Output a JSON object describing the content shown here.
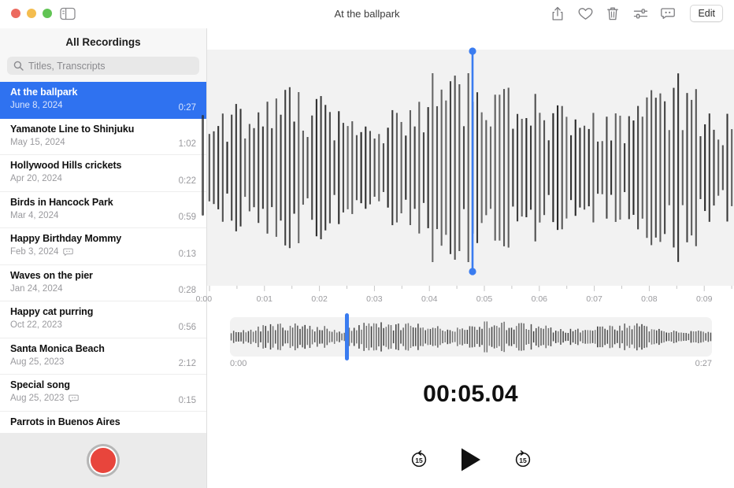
{
  "window": {
    "title": "At the ballpark",
    "traffic_lights": [
      "close-button",
      "minimize-button",
      "zoom-button"
    ],
    "colors": {
      "accent_blue": "#2f72f0",
      "playhead_blue": "#3a7cf0",
      "record_red": "#e8453c",
      "panel_gray": "#f2f2f2",
      "sidebar_gray": "#f7f7f7"
    }
  },
  "toolbar": {
    "sidebar_toggle": "sidebar-toggle-icon",
    "icons": [
      {
        "name": "share-icon",
        "glyph": "share"
      },
      {
        "name": "favorite-heart-icon",
        "glyph": "heart"
      },
      {
        "name": "delete-trash-icon",
        "glyph": "trash"
      },
      {
        "name": "audio-settings-sliders-icon",
        "glyph": "sliders"
      },
      {
        "name": "transcript-icon",
        "glyph": "speech-bubble"
      }
    ],
    "edit_label": "Edit"
  },
  "sidebar": {
    "header": "All Recordings",
    "search": {
      "placeholder": "Titles, Transcripts",
      "value": "",
      "icon": "search-icon"
    },
    "recordings": [
      {
        "title": "At the ballpark",
        "date": "June 8, 2024",
        "duration": "0:27",
        "selected": true,
        "has_transcript": false
      },
      {
        "title": "Yamanote Line to Shinjuku",
        "date": "May 15, 2024",
        "duration": "1:02",
        "selected": false,
        "has_transcript": false
      },
      {
        "title": "Hollywood Hills crickets",
        "date": "Apr 20, 2024",
        "duration": "0:22",
        "selected": false,
        "has_transcript": false
      },
      {
        "title": "Birds in Hancock Park",
        "date": "Mar 4, 2024",
        "duration": "0:59",
        "selected": false,
        "has_transcript": false
      },
      {
        "title": "Happy Birthday Mommy",
        "date": "Feb 3, 2024",
        "duration": "0:13",
        "selected": false,
        "has_transcript": true
      },
      {
        "title": "Waves on the pier",
        "date": "Jan 24, 2024",
        "duration": "0:28",
        "selected": false,
        "has_transcript": false
      },
      {
        "title": "Happy cat purring",
        "date": "Oct 22, 2023",
        "duration": "0:56",
        "selected": false,
        "has_transcript": false
      },
      {
        "title": "Santa Monica Beach",
        "date": "Aug 25, 2023",
        "duration": "2:12",
        "selected": false,
        "has_transcript": false
      },
      {
        "title": "Special song",
        "date": "Aug 25, 2023",
        "duration": "0:15",
        "selected": false,
        "has_transcript": true
      },
      {
        "title": "Parrots in Buenos Aires",
        "date": "",
        "duration": "",
        "selected": false,
        "has_transcript": false
      }
    ],
    "record_button": "record-button"
  },
  "player": {
    "current_time": "00:05.04",
    "playhead_seconds": 4.84,
    "ruler_labels": [
      "0:01",
      "0:02",
      "0:03",
      "0:04",
      "0:05",
      "0:06",
      "0:07",
      "0:08",
      "0:09"
    ],
    "scrubber_start": "0:00",
    "scrubber_end": "0:27",
    "controls": [
      {
        "name": "skip-back-15-button",
        "label": "15"
      },
      {
        "name": "play-button",
        "label": ""
      },
      {
        "name": "skip-forward-15-button",
        "label": "15"
      }
    ]
  }
}
